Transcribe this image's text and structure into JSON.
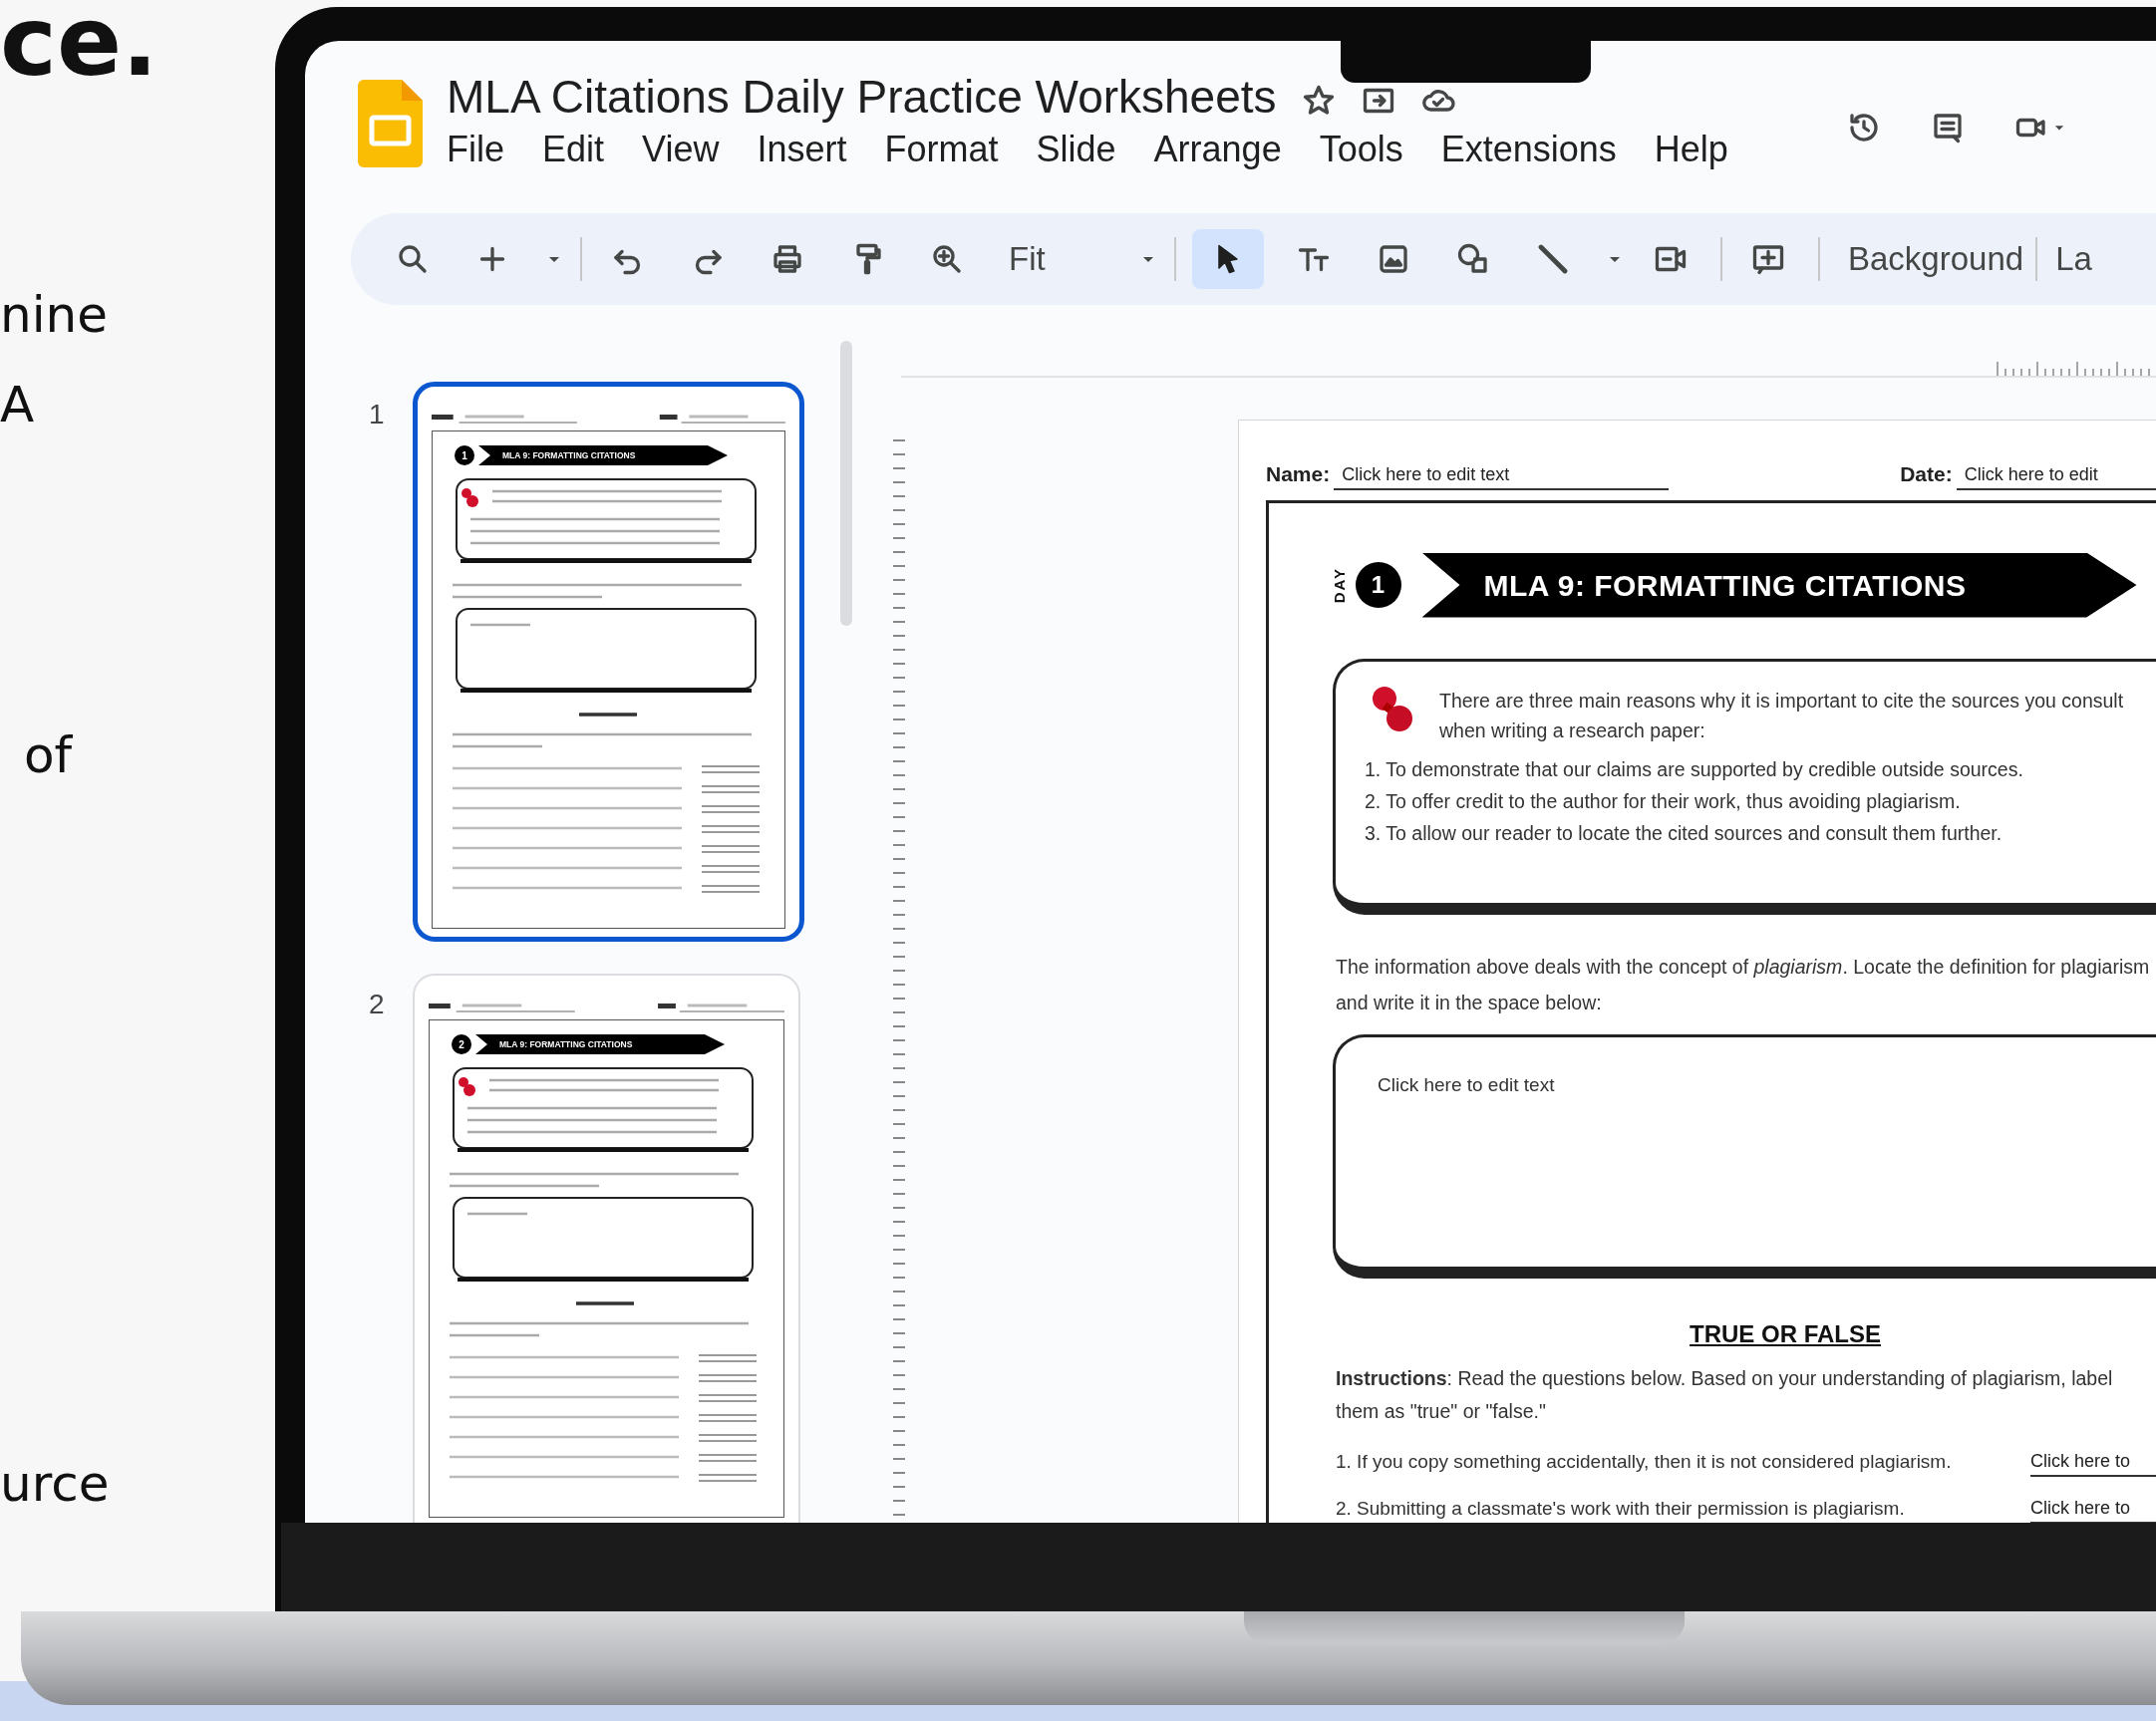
{
  "background_text": [
    "ce.",
    "nine",
    "A",
    "of",
    "urce"
  ],
  "app": {
    "title": "MLA Citations Daily Practice Worksheets",
    "menu": [
      "File",
      "Edit",
      "View",
      "Insert",
      "Format",
      "Slide",
      "Arrange",
      "Tools",
      "Extensions",
      "Help"
    ],
    "toolbar": {
      "zoom": "Fit",
      "select_tool_selected": true,
      "background_button": "Background",
      "cut_button": "La"
    }
  },
  "slides": [
    {
      "number": "1",
      "selected": true,
      "day": "1",
      "banner": "MLA 9: FORMATTING CITATIONS"
    },
    {
      "number": "2",
      "selected": false,
      "day": "2",
      "banner": "MLA 9: FORMATTING CITATIONS"
    }
  ],
  "worksheet": {
    "name_label": "Name:",
    "name_value": "Click here to edit text",
    "date_label": "Date:",
    "date_value": "Click here to edit",
    "day_label": "DAY",
    "day_number": "1",
    "title": "MLA 9: FORMATTING CITATIONS",
    "callout_intro": "There are three main reasons why it is important to cite the sources you consult when writing a research paper:",
    "reasons": [
      "1. To demonstrate that our claims are supported by credible outside sources.",
      "2. To offer credit to the author for their work, thus avoiding plagiarism.",
      "3. To allow our reader to locate the cited sources and consult them further."
    ],
    "prompt": "The information above deals with the concept of *plagiarism*. Locate the definition for plagiarism and write it in the space below:",
    "answer_value": "Click here to edit text",
    "section_title": "TRUE OR FALSE",
    "instructions": "**Instructions**: Read the questions below. Based on your understanding of plagiarism, label them as \"true\" or \"false.\"",
    "questions": [
      {
        "text": "1. If you copy something accidentally, then it is not considered plagiarism.",
        "answer": "Click here to"
      },
      {
        "text": "2. Submitting a classmate's work with their permission is plagiarism.",
        "answer": "Click here to"
      }
    ]
  }
}
